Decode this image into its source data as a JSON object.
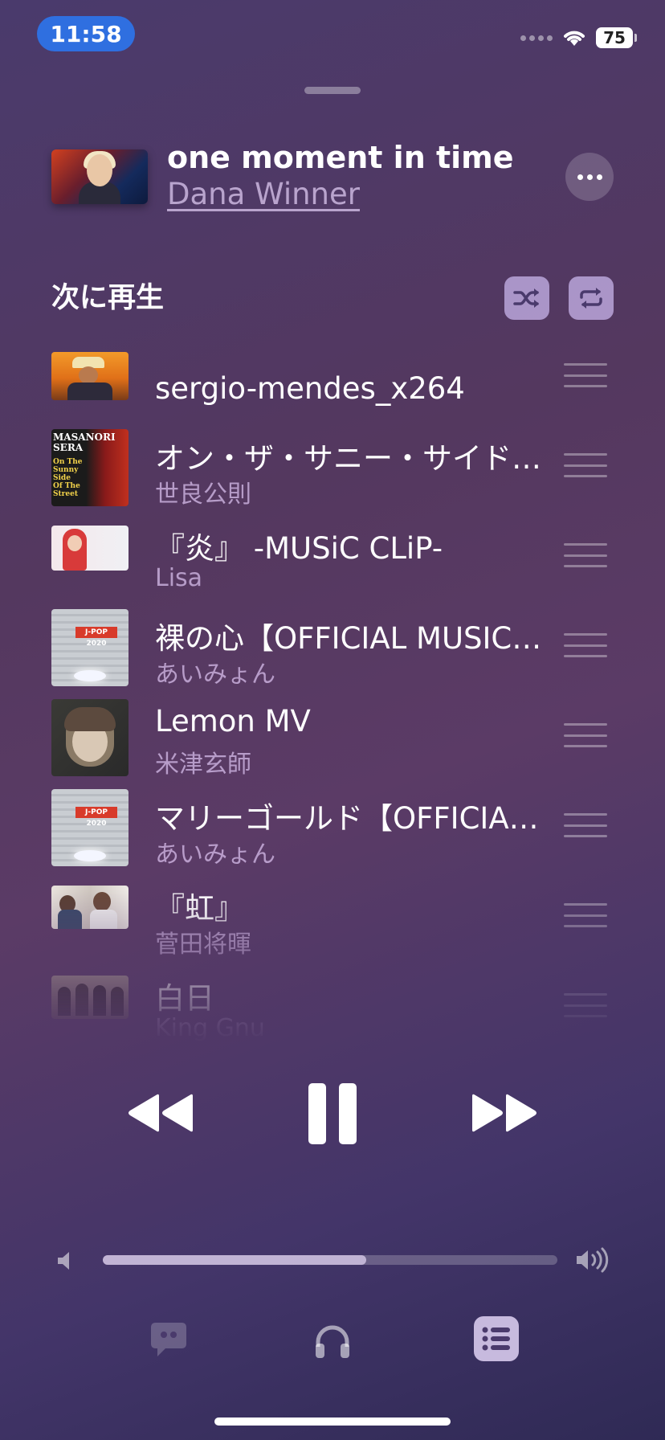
{
  "status_bar": {
    "time": "11:58",
    "battery": "75"
  },
  "now_playing": {
    "title": "one moment in time",
    "artist": "Dana Winner"
  },
  "up_next": {
    "heading": "次に再生",
    "items": [
      {
        "title": "sergio-mendes_x264",
        "artist": ""
      },
      {
        "title": "オン・ザ・サニー・サイド・オブ・ザ・ストリート",
        "artist": "世良公則"
      },
      {
        "title": "『炎』 -MUSiC CLiP-",
        "artist": "Lisa"
      },
      {
        "title": "裸の心【OFFICIAL MUSIC VIDEO】",
        "artist": "あいみょん"
      },
      {
        "title": "Lemon MV",
        "artist": "米津玄師"
      },
      {
        "title": "マリーゴールド【OFFICIAL MUSIC VIDEO】",
        "artist": "あいみょん"
      },
      {
        "title": "『虹』",
        "artist": "菅田将暉"
      },
      {
        "title": "白日",
        "artist": "King Gnu"
      }
    ]
  },
  "thumb_texts": {
    "sera": [
      "MASANORI",
      "SERA",
      "On The",
      "Sunny",
      "Side",
      "Of The",
      "Street"
    ],
    "jpop": [
      "J-POP 2020"
    ]
  },
  "volume": {
    "level": 0.58
  },
  "icons": {
    "shuffle": "shuffle-icon",
    "repeat": "repeat-icon",
    "more": "ellipsis-icon",
    "rewind": "backward-icon",
    "pause": "pause-icon",
    "forward": "forward-icon",
    "lyrics": "quote-bubble-icon",
    "airplay": "headphones-icon",
    "queue": "list-icon"
  },
  "colors": {
    "accent": "#2f6fe0",
    "button_tint": "#c8b4eb"
  }
}
